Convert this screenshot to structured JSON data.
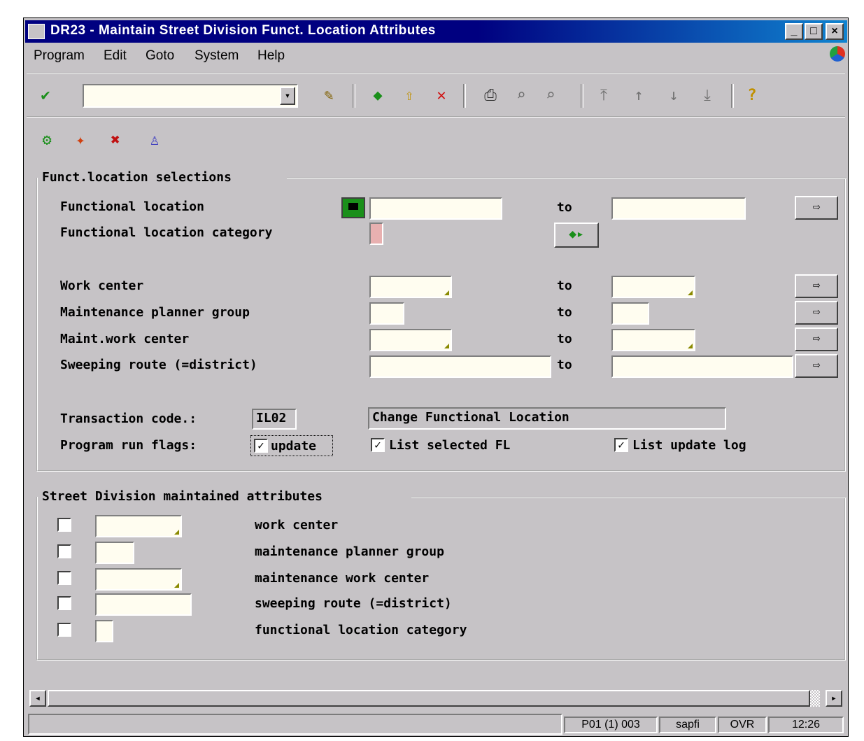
{
  "window": {
    "title": "DR23 - Maintain Street Division Funct. Location Attributes",
    "min_label": "_",
    "max_label": "□",
    "close_label": "×"
  },
  "menu": [
    "Program",
    "Edit",
    "Goto",
    "System",
    "Help"
  ],
  "toolbar": {
    "command_value": "",
    "dropdown_glyph": "▾"
  },
  "selections": {
    "group_title": "Funct.location selections",
    "rows": [
      {
        "label": "Functional location",
        "to": "to"
      },
      {
        "label": "Functional location category"
      },
      {
        "label": "Work center",
        "to": "to"
      },
      {
        "label": "Maintenance planner group",
        "to": "to"
      },
      {
        "label": "Maint.work center",
        "to": "to"
      },
      {
        "label": "Sweeping route (=district)",
        "to": "to"
      }
    ],
    "transaction_label": "Transaction code.:",
    "transaction_code": "IL02",
    "transaction_desc": "Change Functional Location",
    "flags_label": "Program run flags:",
    "flags": [
      {
        "label": "update",
        "checked": true
      },
      {
        "label": "List selected FL",
        "checked": true
      },
      {
        "label": "List update log",
        "checked": true
      }
    ]
  },
  "attributes": {
    "group_title": "Street Division maintained attributes",
    "rows": [
      {
        "label": "work center",
        "checked": false
      },
      {
        "label": "maintenance planner group",
        "checked": false
      },
      {
        "label": "maintenance work center",
        "checked": false
      },
      {
        "label": "sweeping route (=district)",
        "checked": false
      },
      {
        "label": "functional location category",
        "checked": false
      }
    ]
  },
  "status": {
    "system": "P01 (1) 003",
    "server": "sapfi",
    "mode": "OVR",
    "time": "12:26"
  },
  "scroll": {
    "left": "◂",
    "right": "▸"
  },
  "icons": {
    "enter": "check-icon",
    "save": "save-icon",
    "back": "back-icon",
    "exit": "exit-icon",
    "cancel": "cancel-icon",
    "print": "print-icon",
    "find": "find-icon",
    "find_next": "find-next-icon",
    "first_page": "first-page-icon",
    "prev_page": "prev-page-icon",
    "next_page": "next-page-icon",
    "last_page": "last-page-icon",
    "help": "help-icon",
    "execute": "execute-icon",
    "get_variant": "get-variant-icon",
    "delete": "delete-icon",
    "user": "user-icon"
  },
  "colors": {
    "title_bar": "#000080",
    "window_bg": "#c6c3c6",
    "field_bg": "#fffdf0"
  }
}
